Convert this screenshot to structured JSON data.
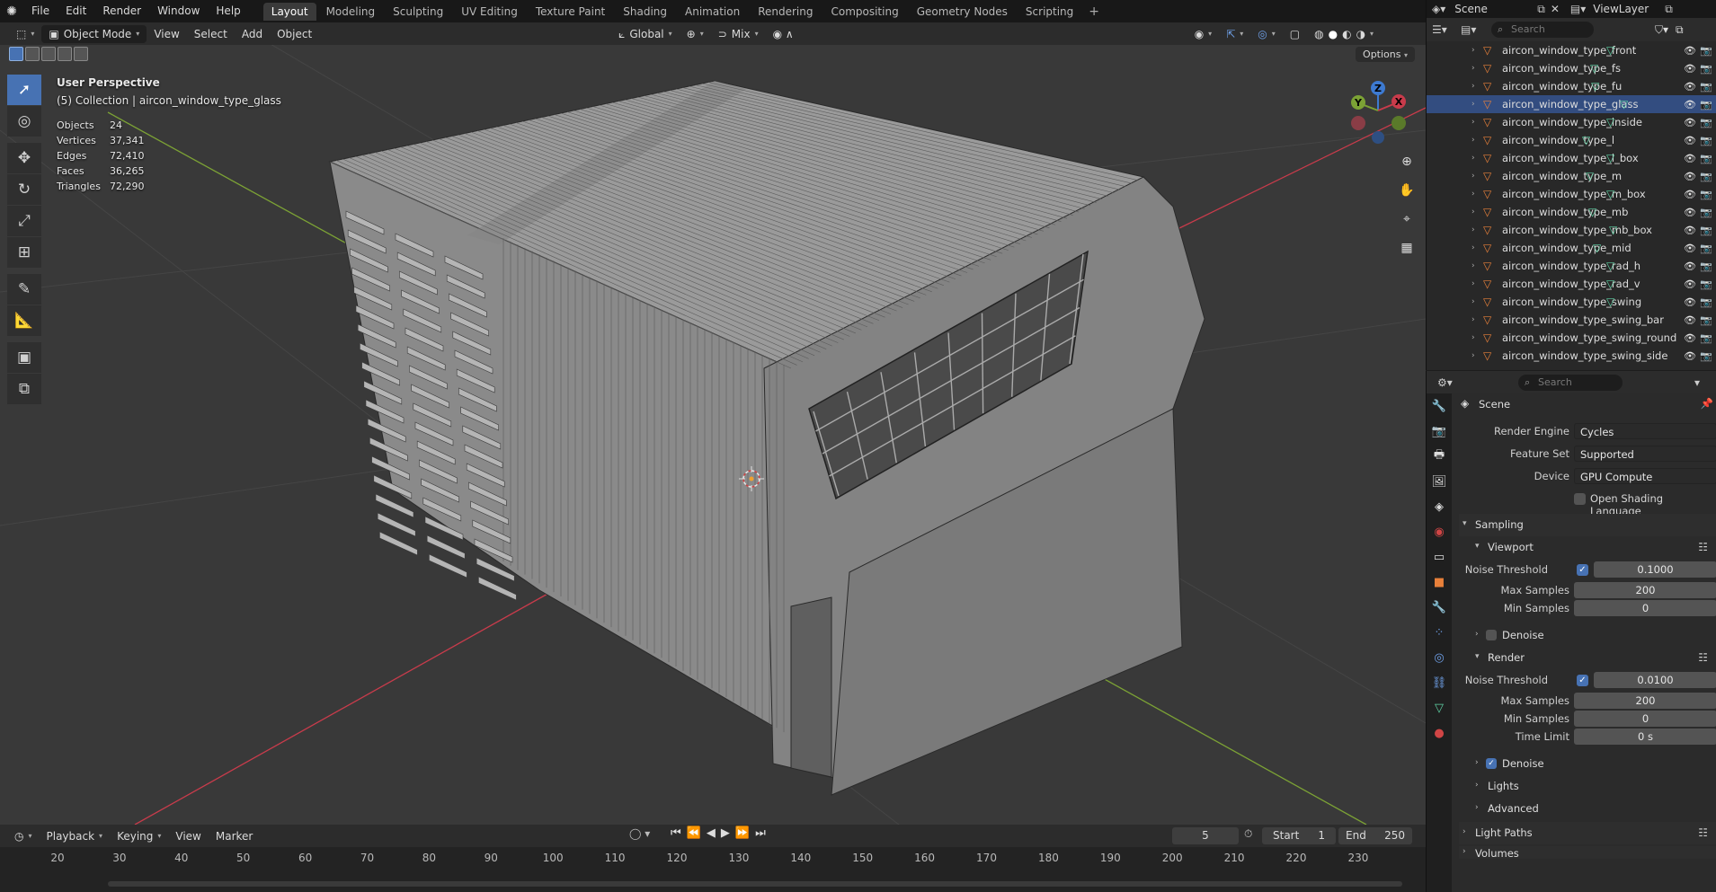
{
  "menu": {
    "items": [
      "File",
      "Edit",
      "Render",
      "Window",
      "Help"
    ],
    "workspaces": [
      "Layout",
      "Modeling",
      "Sculpting",
      "UV Editing",
      "Texture Paint",
      "Shading",
      "Animation",
      "Rendering",
      "Compositing",
      "Geometry Nodes",
      "Scripting"
    ],
    "active_workspace": "Layout"
  },
  "scene_selector": {
    "scene": "Scene",
    "view_layer": "ViewLayer"
  },
  "viewport": {
    "mode": "Object Mode",
    "menus": [
      "View",
      "Select",
      "Add",
      "Object"
    ],
    "orientation": "Global",
    "snap_mode": "Mix",
    "options_label": "Options",
    "perspective_label": "User Perspective",
    "collection_label": "(5) Collection | aircon_window_type_glass",
    "stats": [
      {
        "label": "Objects",
        "value": "24"
      },
      {
        "label": "Vertices",
        "value": "37,341"
      },
      {
        "label": "Edges",
        "value": "72,410"
      },
      {
        "label": "Faces",
        "value": "36,265"
      },
      {
        "label": "Triangles",
        "value": "72,290"
      }
    ],
    "gizmo": {
      "x": "X",
      "y": "Y",
      "z": "Z"
    },
    "axis_colors": {
      "x": "#c83b4b",
      "y": "#7ca235",
      "z": "#3d7ad1"
    }
  },
  "timeline": {
    "menus": [
      "Playback",
      "Keying",
      "View",
      "Marker"
    ],
    "current_frame": "5",
    "start_label": "Start",
    "start": "1",
    "end_label": "End",
    "end": "250",
    "ticks": [
      "20",
      "30",
      "40",
      "50",
      "60",
      "70",
      "80",
      "90",
      "100",
      "110",
      "120",
      "130",
      "140",
      "150",
      "160",
      "170",
      "180",
      "190",
      "200",
      "210",
      "220",
      "230"
    ]
  },
  "outliner": {
    "search_placeholder": "Search",
    "items": [
      {
        "name": "aircon_window_type_front",
        "selected": false
      },
      {
        "name": "aircon_window_type_fs",
        "selected": false
      },
      {
        "name": "aircon_window_type_fu",
        "selected": false
      },
      {
        "name": "aircon_window_type_glass",
        "selected": true
      },
      {
        "name": "aircon_window_type_inside",
        "selected": false
      },
      {
        "name": "aircon_window_type_l",
        "selected": false
      },
      {
        "name": "aircon_window_type_l_box",
        "selected": false
      },
      {
        "name": "aircon_window_type_m",
        "selected": false
      },
      {
        "name": "aircon_window_type_m_box",
        "selected": false
      },
      {
        "name": "aircon_window_type_mb",
        "selected": false
      },
      {
        "name": "aircon_window_type_mb_box",
        "selected": false
      },
      {
        "name": "aircon_window_type_mid",
        "selected": false
      },
      {
        "name": "aircon_window_type_rad_h",
        "selected": false
      },
      {
        "name": "aircon_window_type_rad_v",
        "selected": false
      },
      {
        "name": "aircon_window_type_swing",
        "selected": false
      },
      {
        "name": "aircon_window_type_swing_bar",
        "selected": false
      },
      {
        "name": "aircon_window_type_swing_round",
        "selected": false
      },
      {
        "name": "aircon_window_type_swing_side",
        "selected": false
      }
    ]
  },
  "properties": {
    "search_placeholder": "Search",
    "context": "Scene",
    "render_engine_label": "Render Engine",
    "render_engine": "Cycles",
    "feature_set_label": "Feature Set",
    "feature_set": "Supported",
    "device_label": "Device",
    "device": "GPU Compute",
    "osl_label": "Open Shading Language",
    "sampling_label": "Sampling",
    "viewport_label": "Viewport",
    "noise_threshold_label": "Noise Threshold",
    "viewport_noise_threshold": "0.1000",
    "max_samples_label": "Max Samples",
    "viewport_max_samples": "200",
    "min_samples_label": "Min Samples",
    "viewport_min_samples": "0",
    "denoise_label": "Denoise",
    "render_label": "Render",
    "render_noise_threshold": "0.0100",
    "render_max_samples": "200",
    "render_min_samples": "0",
    "time_limit_label": "Time Limit",
    "time_limit": "0 s",
    "lights_label": "Lights",
    "advanced_label": "Advanced",
    "light_paths_label": "Light Paths",
    "volumes_label": "Volumes"
  }
}
